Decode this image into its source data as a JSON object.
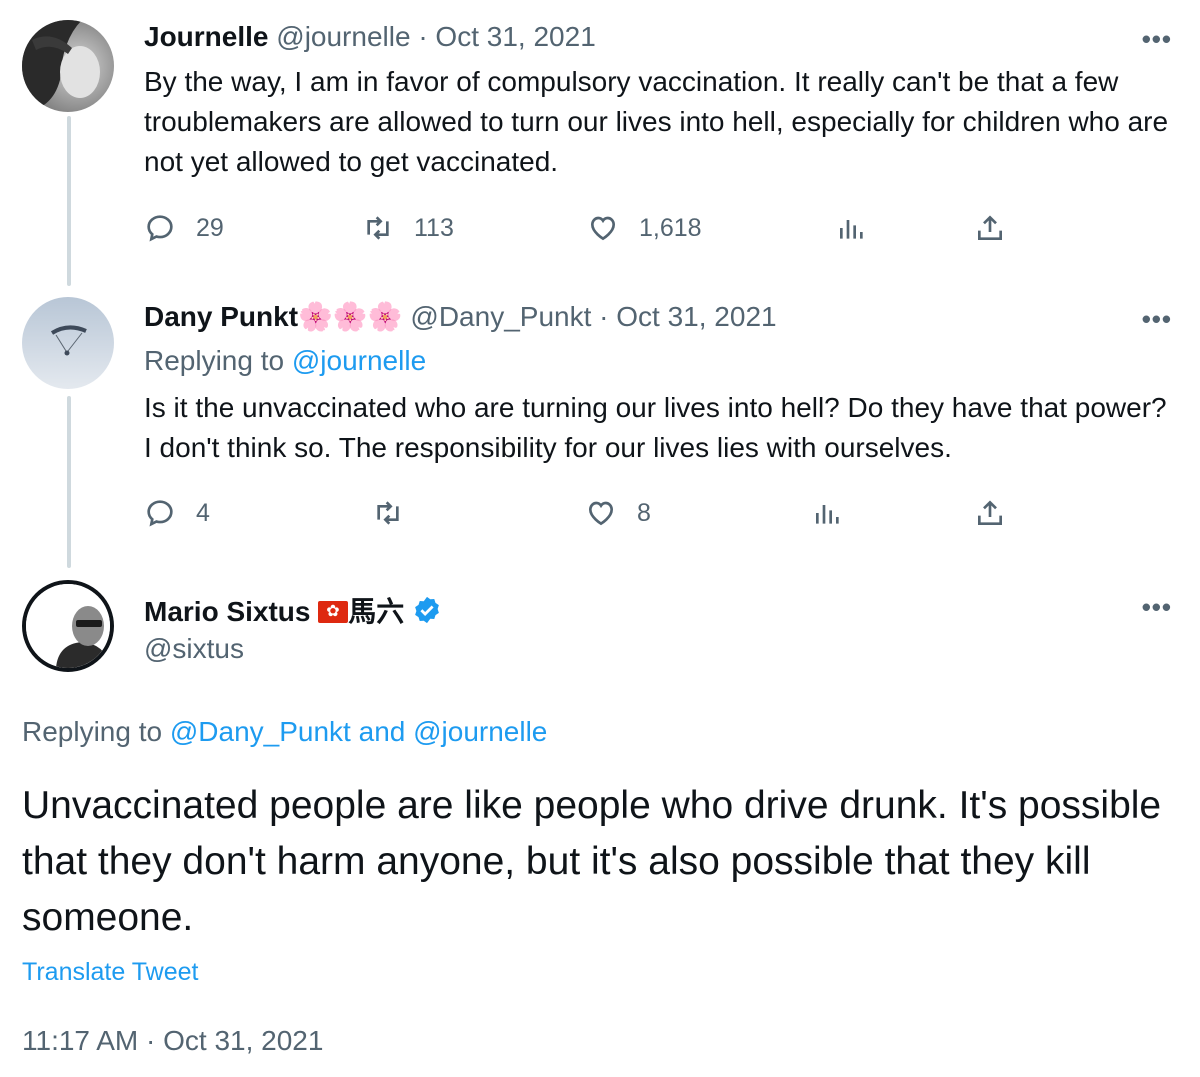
{
  "tweets": [
    {
      "display_name": "Journelle",
      "handle": "@journelle",
      "date": "· Oct 31, 2021",
      "text": "By the way, I am in favor of compulsory vaccination. It really can't be that a few troublemakers are allowed to turn our lives into hell, especially for children who are not yet allowed to get vaccinated.",
      "more": "•••",
      "replies": "29",
      "retweets": "113",
      "likes": "1,618"
    },
    {
      "display_name": "Dany Punkt",
      "name_emoji": "🌸🌸🌸",
      "handle": "@Dany_Punkt",
      "date": "· Oct 31, 2021",
      "replying_prefix": "Replying to",
      "replying_to": "@journelle",
      "text": "Is it the unvaccinated who are turning our lives into hell? Do they have that power? I don't think so. The responsibility for our lives lies with ourselves.",
      "more": "•••",
      "replies": "4",
      "retweets": "",
      "likes": "8"
    },
    {
      "display_name": "Mario Sixtus",
      "name_suffix": "馬六",
      "handle": "@sixtus",
      "more": "•••",
      "replying_prefix": "Replying to",
      "replying_to": "@Dany_Punkt and @journelle",
      "text": "Unvaccinated people are like people who drive drunk. It's possible that they don't harm anyone, but it's also possible that they kill someone.",
      "translate": "Translate Tweet",
      "timestamp": "11:17 AM · Oct 31, 2021"
    }
  ],
  "colors": {
    "accent": "#1d9bf0",
    "muted": "#536471",
    "text": "#0f1419",
    "thread_line": "#cfd9de"
  },
  "icons": [
    "reply-icon",
    "retweet-icon",
    "like-icon",
    "analytics-icon",
    "share-icon",
    "verified-badge-icon",
    "more-icon",
    "hong-kong-flag-icon"
  ]
}
